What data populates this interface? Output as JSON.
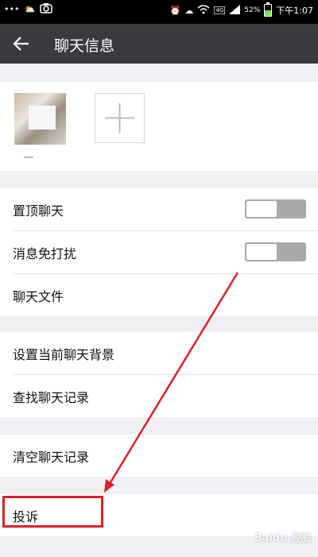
{
  "status_bar": {
    "battery_percent": "52%",
    "time": "下午1:07",
    "network": "4G",
    "icons": [
      "dots-icon",
      "weather-icon",
      "camera-icon",
      "alarm-icon",
      "cloud-icon",
      "wifi-icon",
      "signal-icon",
      "battery-icon"
    ]
  },
  "header": {
    "title": "聊天信息",
    "back_icon": "arrow-left-icon"
  },
  "members": {
    "add_icon": "plus-icon"
  },
  "settings": {
    "group1": [
      {
        "label": "置顶聊天",
        "toggle": false
      },
      {
        "label": "消息免打扰",
        "toggle": false
      },
      {
        "label": "聊天文件"
      }
    ],
    "group2": [
      {
        "label": "设置当前聊天背景"
      },
      {
        "label": "查找聊天记录"
      }
    ],
    "group3": [
      {
        "label": "清空聊天记录"
      }
    ],
    "group4": [
      {
        "label": "投诉"
      }
    ]
  },
  "annotation": {
    "highlight_color": "#d9202a"
  },
  "watermark": "Baidu 经验",
  "colors": {
    "header_bg": "#393a3f",
    "page_bg": "#efeff4",
    "toggle_off": "#a9a9a9"
  }
}
